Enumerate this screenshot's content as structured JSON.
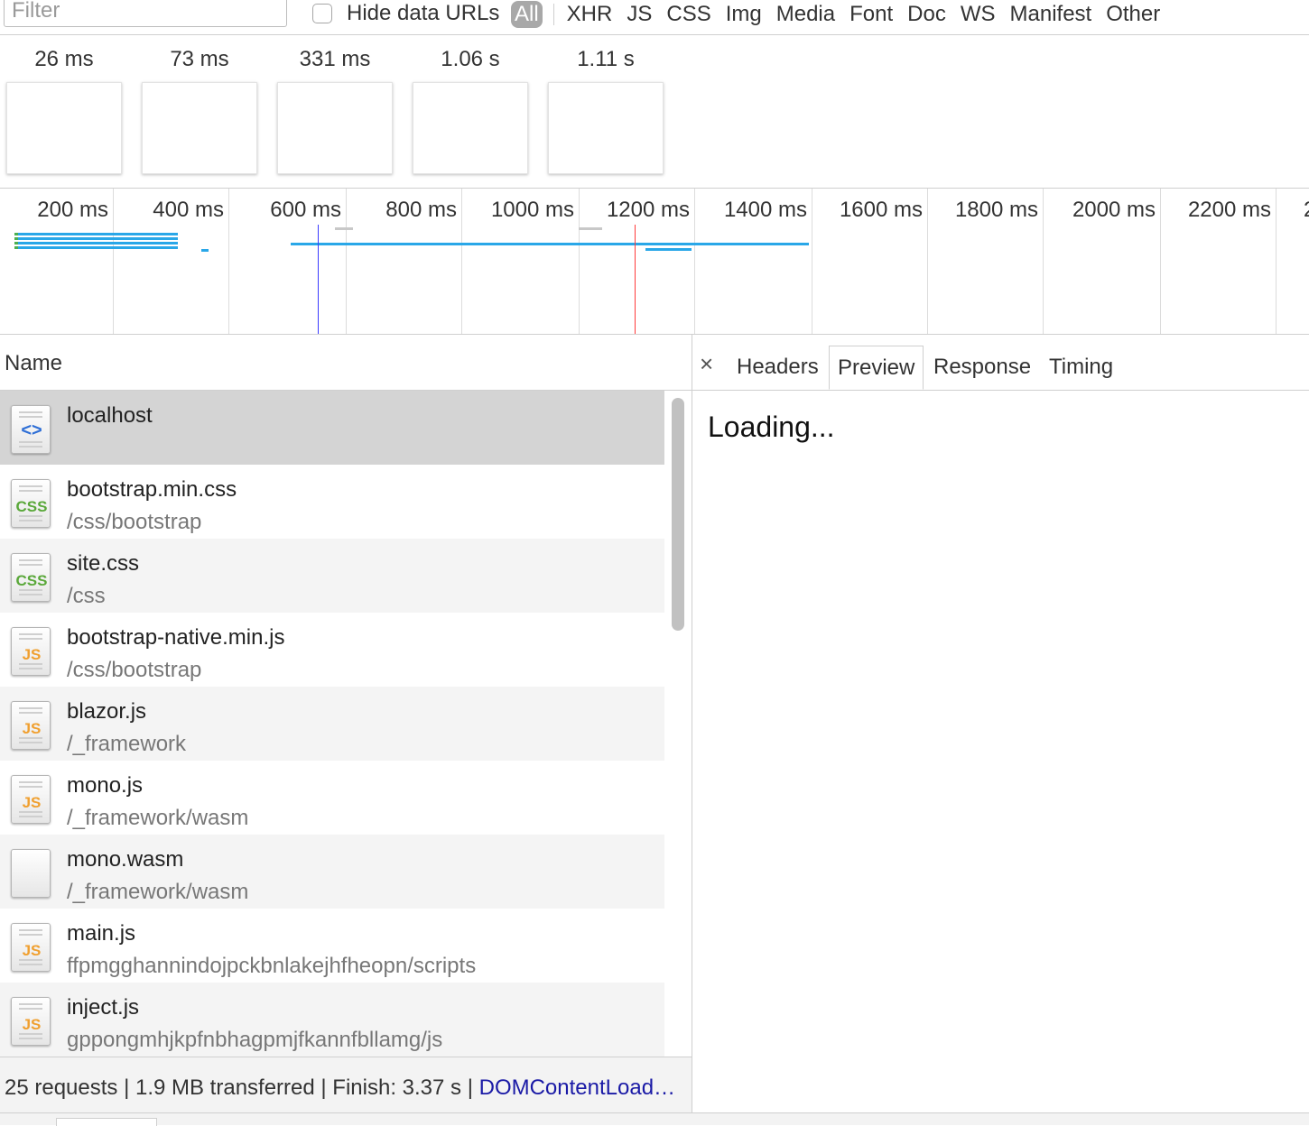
{
  "toolbar": {
    "filter_placeholder": "Filter",
    "hide_data_urls_label": "Hide data URLs",
    "hide_data_urls_checked": false,
    "type_filters": [
      "All",
      "XHR",
      "JS",
      "CSS",
      "Img",
      "Media",
      "Font",
      "Doc",
      "WS",
      "Manifest",
      "Other"
    ],
    "active_type_filter": "All"
  },
  "filmstrip": {
    "frames": [
      "26 ms",
      "73 ms",
      "331 ms",
      "1.06 s",
      "1.11 s"
    ]
  },
  "overview": {
    "tick_labels": [
      "200 ms",
      "400 ms",
      "600 ms",
      "800 ms",
      "1000 ms",
      "1200 ms",
      "1400 ms",
      "1600 ms",
      "1800 ms",
      "2000 ms",
      "2200 ms",
      "2"
    ],
    "colors": {
      "request_bar": "#29a7e8",
      "dom_content_loaded_line": "#3b3bff",
      "load_line": "#ff3b3b"
    }
  },
  "requests": {
    "column_header": "Name",
    "rows": [
      {
        "name": "localhost",
        "path": "",
        "icon": "html-document-icon",
        "type": "html"
      },
      {
        "name": "bootstrap.min.css",
        "path": "/css/bootstrap",
        "icon": "css-file-icon",
        "type": "css"
      },
      {
        "name": "site.css",
        "path": "/css",
        "icon": "css-file-icon",
        "type": "css"
      },
      {
        "name": "bootstrap-native.min.js",
        "path": "/css/bootstrap",
        "icon": "js-file-icon",
        "type": "js"
      },
      {
        "name": "blazor.js",
        "path": "/_framework",
        "icon": "js-file-icon",
        "type": "js"
      },
      {
        "name": "mono.js",
        "path": "/_framework/wasm",
        "icon": "js-file-icon",
        "type": "js"
      },
      {
        "name": "mono.wasm",
        "path": "/_framework/wasm",
        "icon": "blank-file-icon",
        "type": "other"
      },
      {
        "name": "main.js",
        "path": "ffpmgghannindojpckbnlakejhfheopn/scripts",
        "icon": "js-file-icon",
        "type": "js"
      },
      {
        "name": "inject.js",
        "path": "gppongmhjkpfnbhagpmjfkannfbllamg/js",
        "icon": "js-file-icon",
        "type": "js"
      }
    ],
    "selected_index": 0
  },
  "status_bar": {
    "summary": "25 requests | 1.9 MB transferred | Finish: 3.37 s | ",
    "dom_content_loaded": "DOMContentLoad…"
  },
  "details": {
    "close_label": "×",
    "tabs": [
      "Headers",
      "Preview",
      "Response",
      "Timing"
    ],
    "active_tab": "Preview",
    "preview_text": "Loading..."
  }
}
